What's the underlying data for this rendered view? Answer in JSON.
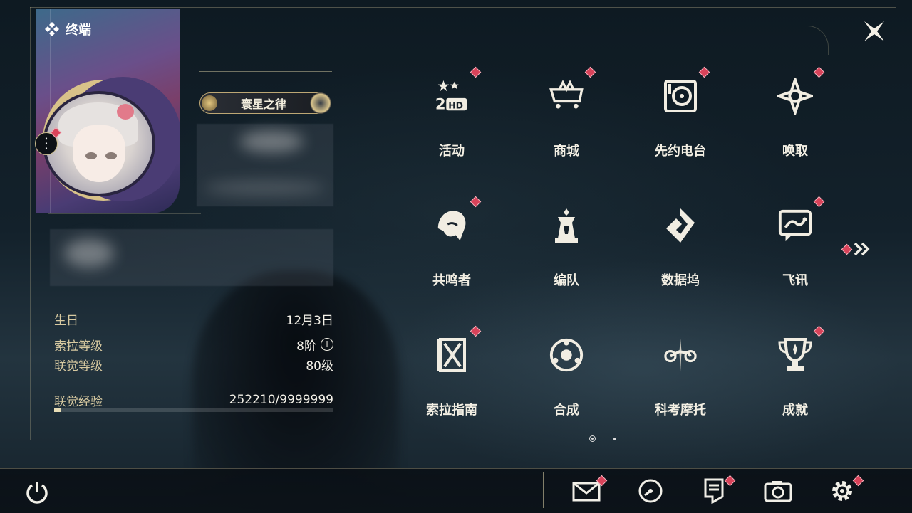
{
  "header": {
    "title": "终端",
    "close_icon": "close-x-icon"
  },
  "profile": {
    "title_badge": "寰星之律",
    "stats": [
      {
        "label": "生日",
        "value": "12月3日"
      },
      {
        "label": "索拉等级",
        "value": "8阶"
      },
      {
        "label": "联觉等级",
        "value": "80级"
      },
      {
        "label": "联觉经验",
        "value": "252210/9999999"
      }
    ],
    "exp_fraction": 0.025
  },
  "grid": {
    "items": [
      {
        "label": "活动",
        "icon": "event-2hd-icon",
        "badge": true
      },
      {
        "label": "商城",
        "icon": "shop-cart-icon",
        "badge": true
      },
      {
        "label": "先约电台",
        "icon": "radio-icon",
        "badge": true
      },
      {
        "label": "唤取",
        "icon": "convene-icon",
        "badge": true
      },
      {
        "label": "共鸣者",
        "icon": "resonator-icon",
        "badge": true
      },
      {
        "label": "编队",
        "icon": "team-chess-icon",
        "badge": false
      },
      {
        "label": "数据坞",
        "icon": "data-bank-icon",
        "badge": false
      },
      {
        "label": "飞讯",
        "icon": "message-icon",
        "badge": true
      },
      {
        "label": "索拉指南",
        "icon": "guide-book-icon",
        "badge": true
      },
      {
        "label": "合成",
        "icon": "synthesis-icon",
        "badge": false
      },
      {
        "label": "科考摩托",
        "icon": "motorcycle-icon",
        "badge": false
      },
      {
        "label": "成就",
        "icon": "trophy-icon",
        "badge": true
      }
    ],
    "page_count": 2,
    "current_page": 1
  },
  "bottom": {
    "icons": [
      "mail-icon",
      "clock-icon",
      "notice-icon",
      "camera-icon",
      "settings-gear-icon"
    ]
  },
  "colors": {
    "accent": "#d9435a",
    "gold": "#d7c9a0"
  }
}
